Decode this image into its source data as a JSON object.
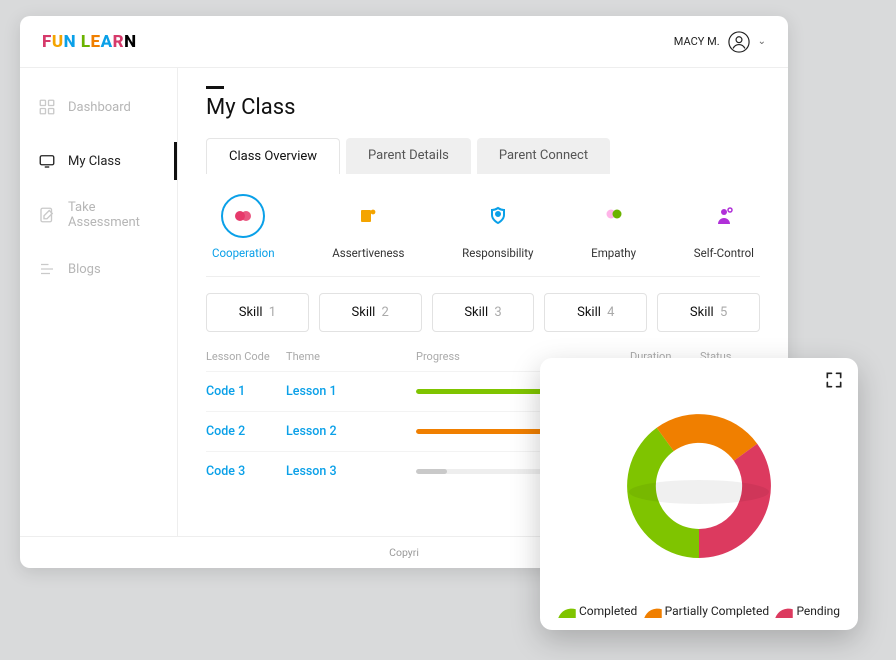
{
  "header": {
    "logo_letters": [
      "F",
      "U",
      "N",
      " ",
      "L",
      "E",
      "A",
      "R",
      "N"
    ],
    "user_label": "MACY M."
  },
  "sidebar": {
    "items": [
      {
        "label": "Dashboard",
        "icon": "dashboard-icon",
        "active": false
      },
      {
        "label": "My Class",
        "icon": "class-icon",
        "active": true
      },
      {
        "label": "Take Assessment",
        "icon": "assessment-icon",
        "active": false
      },
      {
        "label": "Blogs",
        "icon": "blogs-icon",
        "active": false
      }
    ]
  },
  "page": {
    "title": "My Class",
    "tabs": [
      {
        "label": "Class Overview",
        "active": true
      },
      {
        "label": "Parent Details",
        "active": false
      },
      {
        "label": "Parent Connect",
        "active": false
      }
    ],
    "competencies": [
      {
        "label": "Cooperation",
        "color": "#e63a6b",
        "active": true
      },
      {
        "label": "Assertiveness",
        "color": "#f4a400",
        "active": false
      },
      {
        "label": "Responsibility",
        "color": "#0aa0e8",
        "active": false
      },
      {
        "label": "Empathy",
        "color": "#6bb300",
        "active": false
      },
      {
        "label": "Self-Control",
        "color": "#b030d8",
        "active": false
      }
    ],
    "skills": [
      {
        "label": "Skill",
        "n": "1"
      },
      {
        "label": "Skill",
        "n": "2"
      },
      {
        "label": "Skill",
        "n": "3"
      },
      {
        "label": "Skill",
        "n": "4"
      },
      {
        "label": "Skill",
        "n": "5"
      }
    ],
    "columns": {
      "code": "Lesson Code",
      "theme": "Theme",
      "progress": "Progress",
      "duration": "Duration",
      "status": "Status"
    },
    "rows": [
      {
        "code": "Code 1",
        "theme": "Lesson 1",
        "progress": 100,
        "color": "#7fc400"
      },
      {
        "code": "Code 2",
        "theme": "Lesson 2",
        "progress": 100,
        "color": "#f07f00"
      },
      {
        "code": "Code 3",
        "theme": "Lesson 3",
        "progress": 22,
        "color": "#c9c9c9"
      }
    ],
    "footer_text": "Copyri"
  },
  "chart_data": {
    "type": "pie",
    "title": "",
    "series": [
      {
        "name": "Completed",
        "value": 40,
        "color": "#7fc400"
      },
      {
        "name": "Partially Completed",
        "value": 25,
        "color": "#f07f00"
      },
      {
        "name": "Pending",
        "value": 35,
        "color": "#dc3a5f"
      }
    ]
  }
}
